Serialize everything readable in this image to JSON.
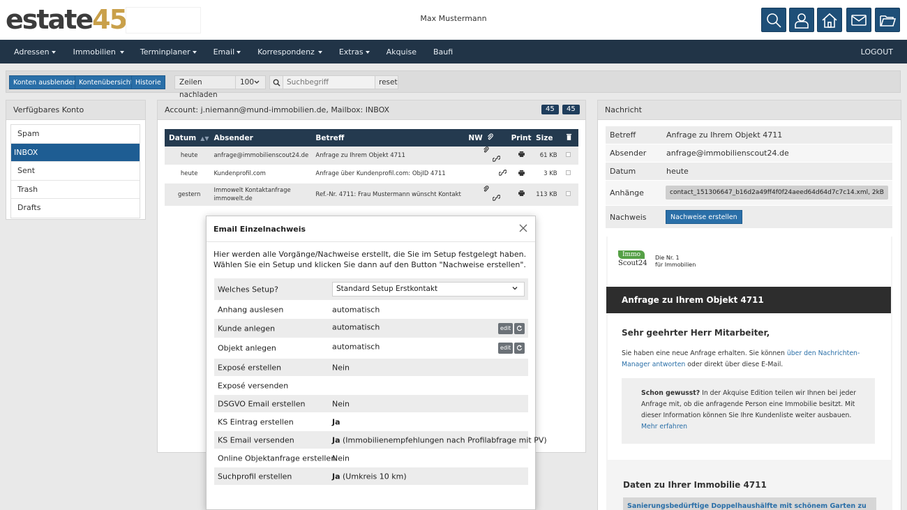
{
  "header": {
    "logo_text_1": "estate",
    "logo_text_2": "45",
    "user_name": "Max Mustermann",
    "icons": [
      "search-icon",
      "user-icon",
      "home-icon",
      "mail-icon",
      "folder-icon"
    ]
  },
  "nav": {
    "items": [
      {
        "label": "Adressen",
        "dropdown": true
      },
      {
        "label": "Immobilien",
        "dropdown": true
      },
      {
        "label": "Terminplaner",
        "dropdown": true
      },
      {
        "label": "Email",
        "dropdown": true
      },
      {
        "label": "Korrespondenz",
        "dropdown": true
      },
      {
        "label": "Extras",
        "dropdown": true
      },
      {
        "label": "Akquise",
        "dropdown": false
      },
      {
        "label": "Baufi",
        "dropdown": false
      }
    ],
    "logout": "LOGOUT"
  },
  "toolbar": {
    "btn_hide": "Konten ausblenden",
    "btn_overview": "Kontenübersicht",
    "btn_history": "Historie",
    "reload_label": "Zeilen nachladen",
    "rows_value": "100",
    "search_placeholder": "Suchbegriff",
    "reset": "reset"
  },
  "accounts": {
    "title": "Verfügbares Konto",
    "items": [
      "Spam",
      "INBOX",
      "Sent",
      "Trash",
      "Drafts"
    ],
    "active": "INBOX"
  },
  "mailbox": {
    "title": "Account: j.niemann@mund-immobilien.de, Mailbox: INBOX",
    "badge1": "45",
    "badge2": "45",
    "columns": {
      "datum": "Datum",
      "absender": "Absender",
      "betreff": "Betreff",
      "nw": "NW",
      "print": "Print",
      "size": "Size"
    },
    "rows": [
      {
        "datum": "heute",
        "absender": "anfrage@immobilienscout24.de",
        "absender2": "",
        "betreff": "Anfrage zu Ihrem Objekt 4711",
        "attach": true,
        "size": "61 KB"
      },
      {
        "datum": "heute",
        "absender": "Kundenprofil.com",
        "absender2": "",
        "betreff": "Anfrage über Kundenprofil.com: ObjID 4711",
        "attach": false,
        "size": "3 KB"
      },
      {
        "datum": "gestern",
        "absender": "Immowelt Kontaktanfrage",
        "absender2": "immowelt.de",
        "betreff": "Ref.-Nr. 4711: Frau Mustermann wünscht Kontakt",
        "attach": true,
        "size": "113 KB"
      }
    ]
  },
  "message": {
    "title": "Nachricht",
    "betreff_label": "Betreff",
    "betreff": "Anfrage zu Ihrem Objekt 4711",
    "absender_label": "Absender",
    "absender": "anfrage@immobilienscout24.de",
    "datum_label": "Datum",
    "datum": "heute",
    "anhaenge_label": "Anhänge",
    "anhang": "contact_151306647_b16d2a49ff4f0f24aeed64d64d7c7c14.xml, 2kB",
    "nachweis_label": "Nachweis",
    "nachweis_btn": "Nachweise erstellen"
  },
  "preview": {
    "logo_immo": "Immo",
    "logo_scout": "Scout24",
    "tagline1": "Die Nr. 1",
    "tagline2": "für Immobilien",
    "band": "Anfrage zu Ihrem Objekt 4711",
    "greeting": "Sehr geehrter Herr Mitarbeiter,",
    "p1_a": "Sie haben eine neue Anfrage erhalten. Sie können ",
    "p1_link": "über den Nachrichten-Manager antworten",
    "p1_b": " oder direkt über diese E-Mail.",
    "box_bold": "Schon gewusst?",
    "box_text": " In der Akquise Edition teilen wir Ihnen bei jeder Anfrage mit, ob die anfragende Person eine Immobilie besitzt. Mit dieser Information können Sie Ihre Kundenliste weiter ausbauen.",
    "box_link": "Mehr erfahren",
    "h2": "Daten zu Ihrer Immobilie 4711",
    "bar": "Sanierungsbedürftige Doppelhaushälfte mit schönem Garten zu verkaufen"
  },
  "modal": {
    "title": "Email Einzelnachweis",
    "intro": "Hier werden alle Vorgänge/Nachweise erstellt, die Sie im Setup festgelegt haben. Wählen Sie ein Setup und klicken Sie dann auf den Button \"Nachweise erstellen\".",
    "setup_label": "Welches Setup?",
    "setup_value": "Standard Setup Erstkontakt",
    "edit": "edit",
    "rows": [
      {
        "k": "Anhang auslesen",
        "v": "automatisch"
      },
      {
        "k": "Kunde anlegen",
        "v": "automatisch"
      },
      {
        "k": "Objekt anlegen",
        "v": "automatisch"
      },
      {
        "k": "Exposé erstellen",
        "v": "Nein"
      },
      {
        "k": "Exposé versenden",
        "v": ""
      },
      {
        "k": "DSGVO Email erstellen",
        "v": "Nein"
      },
      {
        "k": "KS Eintrag erstellen",
        "v_bold": "Ja",
        "v": ""
      },
      {
        "k": "KS Email versenden",
        "v_bold": "Ja",
        "v": " (Immobilienempfehlungen nach Profilabfrage mit PV)"
      },
      {
        "k": "Online Objektanfrage erstellen",
        "v": "Nein"
      },
      {
        "k": "Suchprofil erstellen",
        "v_bold": "Ja",
        "v": " (Umkreis 10 km)"
      }
    ]
  }
}
